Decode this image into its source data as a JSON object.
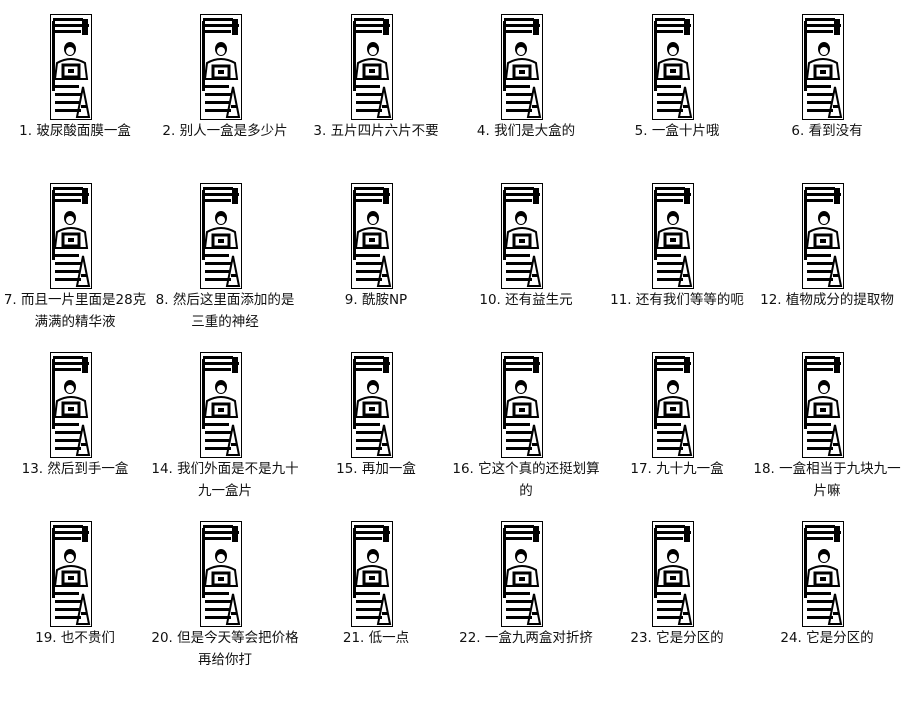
{
  "frames": [
    {
      "caption": "1. 玻尿酸面膜一盒"
    },
    {
      "caption": "2. 别人一盒是多少片"
    },
    {
      "caption": "3. 五片四片六片不要"
    },
    {
      "caption": "4. 我们是大盒的"
    },
    {
      "caption": "5. 一盒十片哦"
    },
    {
      "caption": "6. 看到没有"
    },
    {
      "caption": "7. 而且一片里面是28克满满的精华液"
    },
    {
      "caption": "8. 然后这里面添加的是三重的神经"
    },
    {
      "caption": "9. 酰胺NP"
    },
    {
      "caption": "10. 还有益生元"
    },
    {
      "caption": "11. 还有我们等等的呃"
    },
    {
      "caption": "12. 植物成分的提取物"
    },
    {
      "caption": "13. 然后到手一盒"
    },
    {
      "caption": "14. 我们外面是不是九十九一盒片"
    },
    {
      "caption": "15. 再加一盒"
    },
    {
      "caption": "16. 它这个真的还挺划算的"
    },
    {
      "caption": "17. 九十九一盒"
    },
    {
      "caption": "18. 一盒相当于九块九一片嘛"
    },
    {
      "caption": "19. 也不贵们"
    },
    {
      "caption": "20. 但是今天等会把价格再给你打"
    },
    {
      "caption": "21. 低一点"
    },
    {
      "caption": "22. 一盒九两盒对折挤"
    },
    {
      "caption": "23. 它是分区的"
    },
    {
      "caption": "24. 它是分区的"
    }
  ]
}
